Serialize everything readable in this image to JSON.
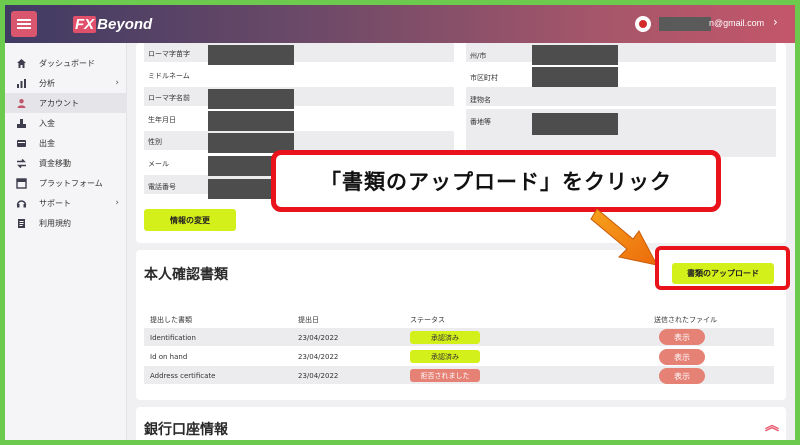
{
  "header": {
    "logo_mark": "FX",
    "logo_text": "Beyond",
    "email_suffix": "n@gmail.com"
  },
  "sidebar": {
    "items": [
      {
        "label": "ダッシュボード",
        "icon": "home-icon"
      },
      {
        "label": "分析",
        "icon": "chart-icon",
        "has_chevron": true
      },
      {
        "label": "アカウント",
        "icon": "user-icon",
        "active": true
      },
      {
        "label": "入金",
        "icon": "deposit-icon"
      },
      {
        "label": "出金",
        "icon": "withdraw-icon"
      },
      {
        "label": "資金移動",
        "icon": "transfer-icon"
      },
      {
        "label": "プラットフォーム",
        "icon": "platform-icon"
      },
      {
        "label": "サポート",
        "icon": "support-icon",
        "has_chevron": true
      },
      {
        "label": "利用規約",
        "icon": "terms-icon"
      }
    ]
  },
  "profile": {
    "left_fields": [
      "ローマ字苗字",
      "ミドルネーム",
      "ローマ字名前",
      "生年月日",
      "性別",
      "メール",
      "電話番号"
    ],
    "right_fields": [
      "州/市",
      "市区町村",
      "建物名",
      "番地等"
    ],
    "edit_button": "情報の変更"
  },
  "documents": {
    "title": "本人確認書類",
    "upload_button": "書類のアップロード",
    "columns": [
      "提出した書類",
      "提出日",
      "ステータス",
      "送信されたファイル"
    ],
    "rows": [
      {
        "name": "Identification",
        "date": "23/04/2022",
        "status": "承認済み",
        "status_type": "approved",
        "action": "表示"
      },
      {
        "name": "Id on hand",
        "date": "23/04/2022",
        "status": "承認済み",
        "status_type": "approved",
        "action": "表示"
      },
      {
        "name": "Address certificate",
        "date": "23/04/2022",
        "status": "拒否されました",
        "status_type": "rejected",
        "action": "表示"
      }
    ]
  },
  "bank": {
    "title": "銀行口座情報"
  },
  "annotation": {
    "callout_text": "「書類のアップロード」をクリック"
  },
  "colors": {
    "accent_lime": "#d4f01a",
    "accent_red": "#e8131b",
    "badge_rejected": "#e58275",
    "frame_green": "#6ccb4e"
  }
}
